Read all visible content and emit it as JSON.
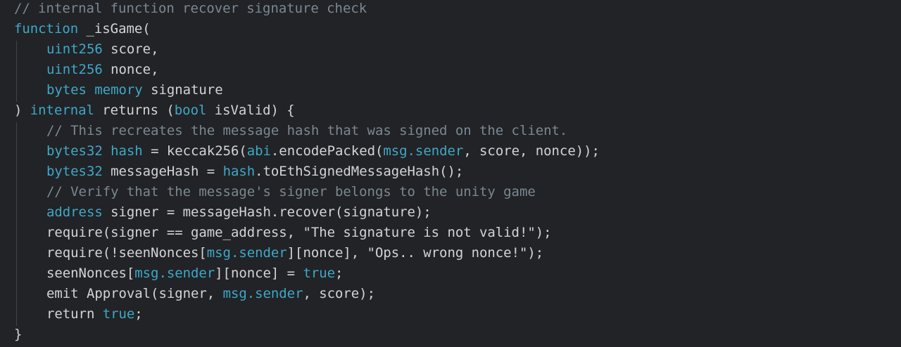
{
  "code": {
    "lines": [
      [
        {
          "t": "// internal function recover signature check",
          "c": "comment"
        }
      ],
      [
        {
          "t": "function",
          "c": "kw"
        },
        {
          "t": " _isGame(",
          "c": "txt"
        }
      ],
      [
        {
          "t": "uint256",
          "c": "kw"
        },
        {
          "t": " score,",
          "c": "txt"
        }
      ],
      [
        {
          "t": "uint256",
          "c": "kw"
        },
        {
          "t": " nonce,",
          "c": "txt"
        }
      ],
      [
        {
          "t": "bytes",
          "c": "kw"
        },
        {
          "t": " ",
          "c": "txt"
        },
        {
          "t": "memory",
          "c": "kw"
        },
        {
          "t": " signature",
          "c": "txt"
        }
      ],
      [
        {
          "t": ") ",
          "c": "txt"
        },
        {
          "t": "internal",
          "c": "kw"
        },
        {
          "t": " returns (",
          "c": "txt"
        },
        {
          "t": "bool",
          "c": "kw"
        },
        {
          "t": " isValid) {",
          "c": "txt"
        }
      ],
      [
        {
          "t": "// This recreates the message hash that was signed on the client.",
          "c": "comment"
        }
      ],
      [
        {
          "t": "bytes32",
          "c": "kw"
        },
        {
          "t": " ",
          "c": "txt"
        },
        {
          "t": "hash",
          "c": "kw"
        },
        {
          "t": " = keccak256(",
          "c": "txt"
        },
        {
          "t": "abi",
          "c": "kw"
        },
        {
          "t": ".encodePacked(",
          "c": "txt"
        },
        {
          "t": "msg.sender",
          "c": "kw"
        },
        {
          "t": ", score, nonce));",
          "c": "txt"
        }
      ],
      [
        {
          "t": "bytes32",
          "c": "kw"
        },
        {
          "t": " messageHash = ",
          "c": "txt"
        },
        {
          "t": "hash",
          "c": "kw"
        },
        {
          "t": ".toEthSignedMessageHash();",
          "c": "txt"
        }
      ],
      [
        {
          "t": "// Verify that the message's signer belongs to the unity game",
          "c": "comment"
        }
      ],
      [
        {
          "t": "address",
          "c": "kw"
        },
        {
          "t": " signer = messageHash.recover(signature);",
          "c": "txt"
        }
      ],
      [
        {
          "t": "require(signer == game_address, \"The signature is not valid!\");",
          "c": "txt"
        }
      ],
      [
        {
          "t": "require(!seenNonces[",
          "c": "txt"
        },
        {
          "t": "msg.sender",
          "c": "kw"
        },
        {
          "t": "][nonce], \"Ops.. wrong nonce!\");",
          "c": "txt"
        }
      ],
      [
        {
          "t": "seenNonces[",
          "c": "txt"
        },
        {
          "t": "msg.sender",
          "c": "kw"
        },
        {
          "t": "][nonce] = ",
          "c": "txt"
        },
        {
          "t": "true",
          "c": "kw"
        },
        {
          "t": ";",
          "c": "txt"
        }
      ],
      [
        {
          "t": "emit Approval(signer, ",
          "c": "txt"
        },
        {
          "t": "msg.sender",
          "c": "kw"
        },
        {
          "t": ", score);",
          "c": "txt"
        }
      ],
      [
        {
          "t": "return ",
          "c": "txt"
        },
        {
          "t": "true",
          "c": "kw"
        },
        {
          "t": ";",
          "c": "txt"
        }
      ],
      [
        {
          "t": "}",
          "c": "txt"
        }
      ]
    ],
    "indents": [
      0,
      0,
      1,
      1,
      1,
      0,
      1,
      1,
      1,
      1,
      1,
      1,
      1,
      1,
      1,
      1,
      0
    ]
  },
  "colors": {
    "background": "#212327",
    "keyword": "#3fa8c6",
    "comment": "#7b8891",
    "text": "#d4d4d4"
  }
}
